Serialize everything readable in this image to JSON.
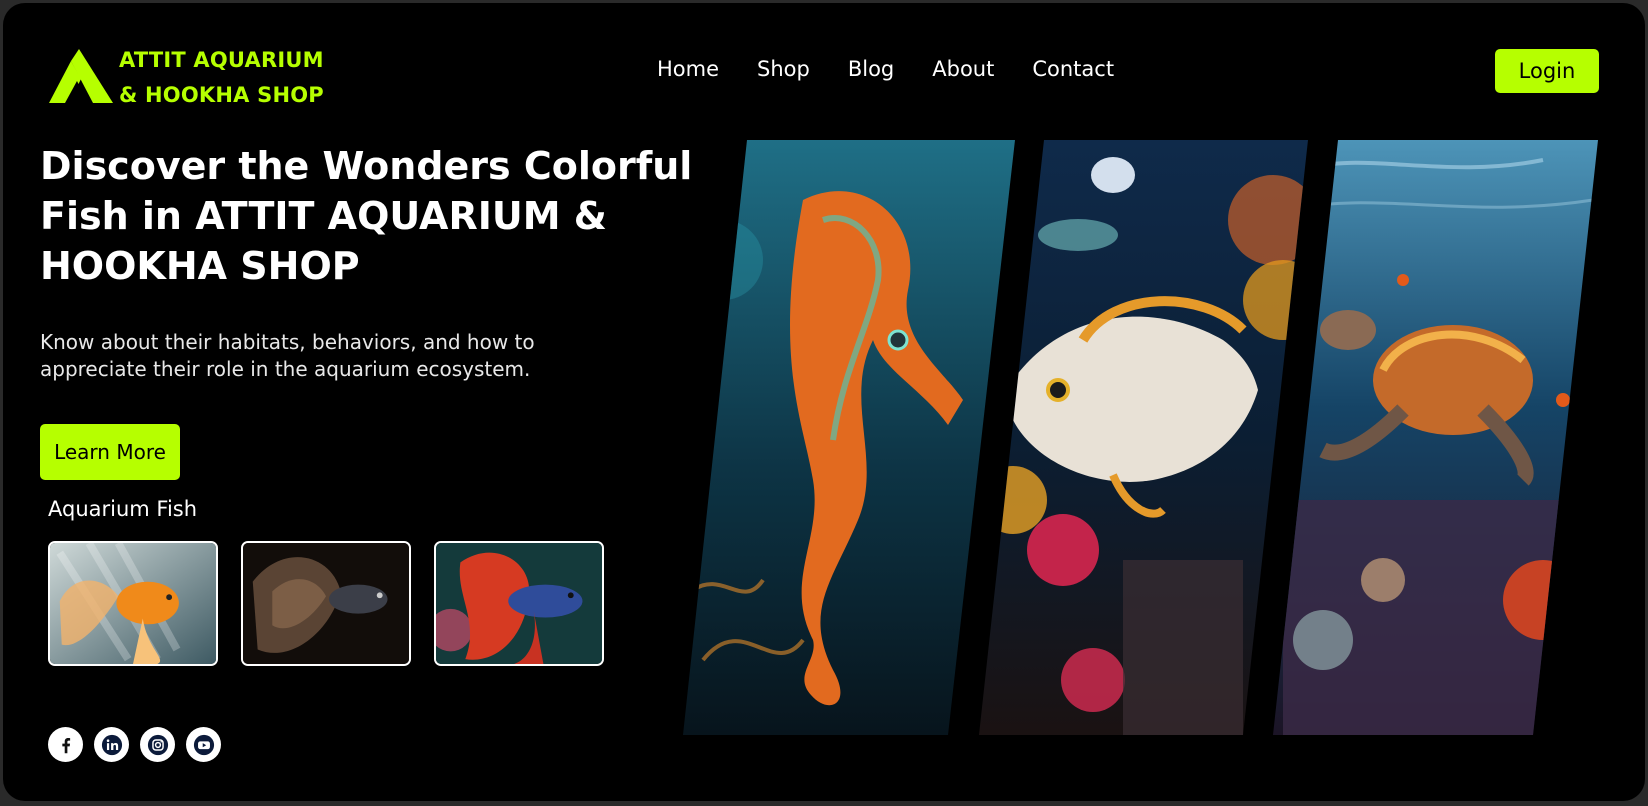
{
  "brand": {
    "line1": "ATTIT AQUARIUM",
    "line2": "& HOOKHA SHOP",
    "accent": "#b6ff00"
  },
  "nav": {
    "items": [
      {
        "label": "Home"
      },
      {
        "label": "Shop"
      },
      {
        "label": "Blog"
      },
      {
        "label": "About"
      },
      {
        "label": "Contact"
      }
    ],
    "login_label": "Login"
  },
  "hero": {
    "title": "Discover the Wonders Colorful Fish in ATTIT AQUARIUM & HOOKHA SHOP",
    "subtitle": "Know about their habitats, behaviors, and how to appreciate their role in the aquarium  ecosystem.",
    "cta_label": "Learn More"
  },
  "fish_section": {
    "label": "Aquarium Fish",
    "thumbnails": [
      {
        "icon": "goldfish-image"
      },
      {
        "icon": "dark-betta-image"
      },
      {
        "icon": "red-betta-image"
      }
    ]
  },
  "panels": [
    {
      "icon": "seahorse-image"
    },
    {
      "icon": "reef-fish-image"
    },
    {
      "icon": "sea-turtle-image"
    }
  ],
  "social": [
    {
      "icon": "facebook-icon"
    },
    {
      "icon": "linkedin-icon"
    },
    {
      "icon": "instagram-icon"
    },
    {
      "icon": "youtube-icon"
    }
  ]
}
